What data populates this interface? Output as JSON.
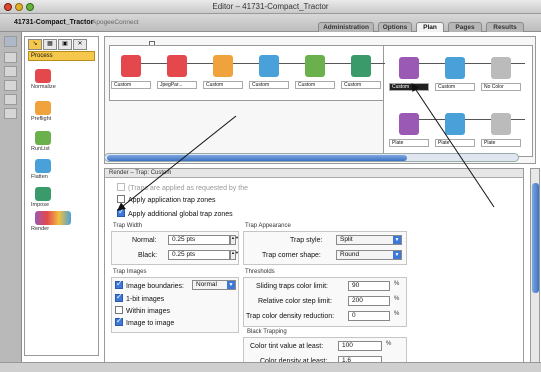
{
  "window": {
    "title": "Editor – 41731-Compact_Tractor"
  },
  "job": {
    "name": "41731-Compact_Tractor",
    "subtitle": "ApogeeConnect"
  },
  "tabs": [
    {
      "label": "Administration",
      "active": false
    },
    {
      "label": "Options",
      "active": false
    },
    {
      "label": "Plan",
      "active": true
    },
    {
      "label": "Pages",
      "active": false
    },
    {
      "label": "Results",
      "active": false
    }
  ],
  "palette": {
    "header": "Process",
    "items": [
      {
        "label": "Normalize",
        "icon": "normalize-icon",
        "color": "#e4474c"
      },
      {
        "label": "Preflight",
        "icon": "preflight-icon",
        "color": "#f0a33c"
      },
      {
        "label": "RunList",
        "icon": "runlist-icon",
        "color": "#6ab04c"
      },
      {
        "label": "Flatten",
        "icon": "flatten-icon",
        "color": "#4aa0d8"
      },
      {
        "label": "Impose",
        "icon": "impose-icon",
        "color": "#3a9a6a"
      },
      {
        "label": "Render",
        "icon": "render-icon",
        "color": "#9b59b6"
      }
    ]
  },
  "plan": {
    "nodes": [
      {
        "label": "Custom",
        "icon": "normalize-icon",
        "color": "#e4474c"
      },
      {
        "label": "JpegPar...",
        "icon": "normalize-icon",
        "color": "#e4474c"
      },
      {
        "label": "Custom",
        "icon": "preflight-icon",
        "color": "#f0a33c"
      },
      {
        "label": "Custom",
        "icon": "runlist-icon",
        "color": "#4aa0d8"
      },
      {
        "label": "Custom",
        "icon": "flatten-icon",
        "color": "#6ab04c"
      },
      {
        "label": "Custom",
        "icon": "impose-icon",
        "color": "#3a9a6a"
      },
      {
        "label": "Custom",
        "icon": "render-icon",
        "color": "#9b59b6"
      },
      {
        "label": "Custom",
        "icon": "render-icon",
        "color": "#4aa0d8"
      },
      {
        "label": "No Color",
        "icon": "output-icon",
        "color": "#bbbbbb"
      },
      {
        "label": "Plate",
        "icon": "render-icon",
        "color": "#9b59b6"
      },
      {
        "label": "Plate",
        "icon": "render-icon",
        "color": "#4aa0d8"
      },
      {
        "label": "Plate",
        "icon": "output-icon",
        "color": "#bbbbbb"
      }
    ]
  },
  "settings": {
    "header": "Render – Trap: Custom",
    "traps_note": "(Traps are applied as requested by the",
    "apply_app_trap": "Apply application trap zones",
    "apply_global_trap": "Apply additional global trap zones",
    "trap_width": {
      "title": "Trap Width",
      "normal_label": "Normal:",
      "normal_value": "0.25 pts",
      "black_label": "Black:",
      "black_value": "0.25 pts"
    },
    "trap_appearance": {
      "title": "Trap Appearance",
      "style_label": "Trap style:",
      "style_value": "Split",
      "corner_label": "Trap corner shape:",
      "corner_value": "Round"
    },
    "trap_images": {
      "title": "Trap Images",
      "boundaries_label": "Image boundaries:",
      "boundaries_value": "Normal",
      "one_bit": "1-bit images",
      "within": "Within images",
      "image_to_image": "Image to image"
    },
    "thresholds": {
      "title": "Thresholds",
      "sliding_label": "Sliding traps color limit:",
      "sliding_value": "90",
      "relative_label": "Relative color step limit:",
      "relative_value": "200",
      "density_label": "Trap color density reduction:",
      "density_value": "0",
      "percent": "%"
    },
    "black_trapping": {
      "title": "Black Trapping",
      "tint_label": "Color tint value at least:",
      "tint_value": "100",
      "density_label": "Color density at least:",
      "density_value": "1.6"
    }
  }
}
